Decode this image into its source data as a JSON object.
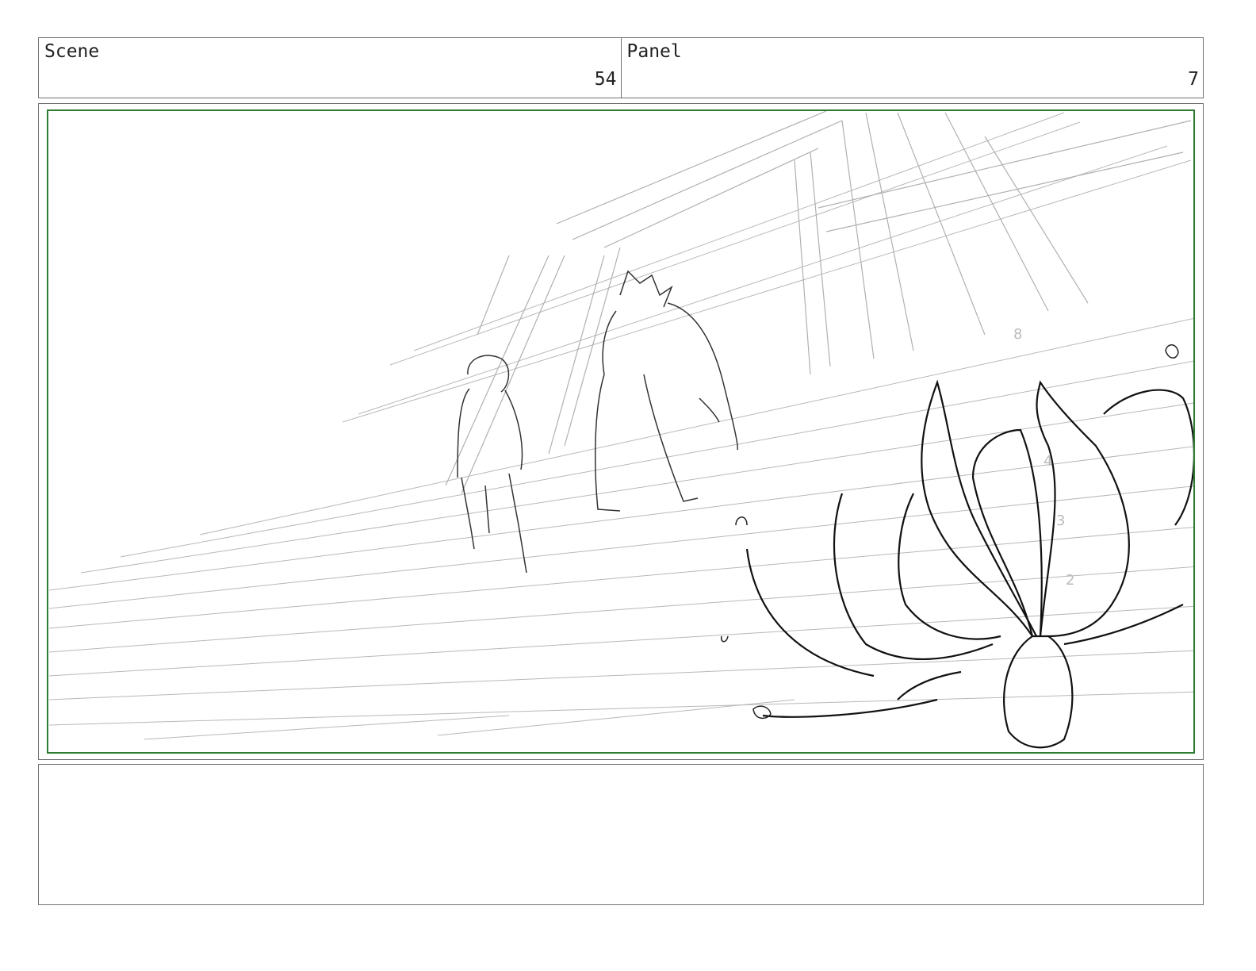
{
  "header": {
    "scene_label": "Scene",
    "scene_number": "54",
    "panel_label": "Panel",
    "panel_number": "7"
  },
  "panel": {
    "frame_color": "#2f7d32"
  },
  "notes": {
    "text": ""
  }
}
